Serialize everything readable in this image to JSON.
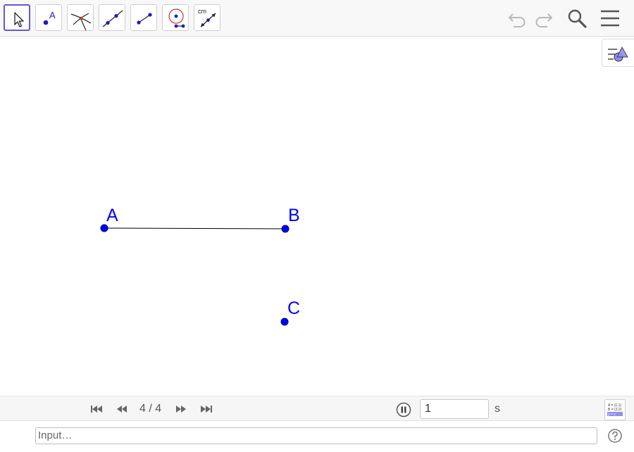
{
  "toolbar": {
    "tools": [
      {
        "name": "move-tool",
        "selected": true
      },
      {
        "name": "point-tool",
        "label": "A"
      },
      {
        "name": "intersect-tool"
      },
      {
        "name": "line-tool"
      },
      {
        "name": "segment-tool"
      },
      {
        "name": "circle-center-point-tool"
      },
      {
        "name": "distance-tool",
        "label": "cm"
      }
    ],
    "right_icons": [
      "undo-icon",
      "redo-icon",
      "search-icon",
      "menu-icon"
    ]
  },
  "graphics": {
    "style_bar_icon": "graphics-style-bar-icon",
    "points": [
      {
        "label": "A"
      },
      {
        "label": "B"
      },
      {
        "label": "C"
      }
    ],
    "segments": [
      {
        "from": "A",
        "to": "B"
      }
    ],
    "colors": {
      "point": "#0000ff",
      "label": "#0000ff",
      "segment": "#000000",
      "selection": "#6557d2"
    }
  },
  "playbar": {
    "page_counter": "4 / 4",
    "speed_value": "1",
    "speed_unit": "s",
    "buttons": [
      "first-slide-icon",
      "previous-slide-icon",
      "next-slide-icon",
      "last-slide-icon",
      "pause-icon"
    ],
    "algebra_icon": {
      "lines": [
        "A = (1,1)",
        "B = (2,2)",
        "y = x"
      ]
    }
  },
  "inputbar": {
    "placeholder": "Input…",
    "help_icon": "help-icon"
  }
}
